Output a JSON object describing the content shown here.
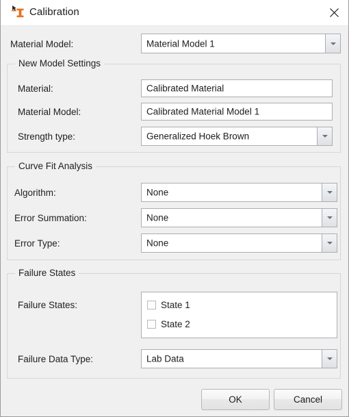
{
  "window": {
    "title": "Calibration",
    "icon": "calibration-specimen-icon",
    "close_label": "✕",
    "accent_color": "#E8731E",
    "titlebar_bg": "#FFFFFF",
    "content_bg": "#F0F0F0"
  },
  "top_field": {
    "label": "Material Model:",
    "value": "Material Model 1"
  },
  "new_model_settings": {
    "caption": "New Model Settings",
    "fields": [
      {
        "label": "Material:",
        "value": "Calibrated Material",
        "type": "textbox"
      },
      {
        "label": "Material Model:",
        "value": "Calibrated Material Model 1",
        "type": "textbox"
      },
      {
        "label": "Strength type:",
        "value": "Generalized Hoek Brown",
        "type": "combobox"
      }
    ]
  },
  "curve_fit_analysis": {
    "caption": "Curve Fit Analysis",
    "fields": [
      {
        "label": "Algorithm:",
        "value": "None",
        "type": "combobox"
      },
      {
        "label": "Error Summation:",
        "value": "None",
        "type": "combobox"
      },
      {
        "label": "Error Type:",
        "value": "None",
        "type": "combobox"
      }
    ]
  },
  "failure_states": {
    "caption": "Failure States",
    "list_label": "Failure States:",
    "items": [
      {
        "label": "State 1",
        "checked": false
      },
      {
        "label": "State 2",
        "checked": false
      }
    ],
    "data_type": {
      "label": "Failure Data Type:",
      "value": "Lab Data"
    }
  },
  "buttons": {
    "ok": "OK",
    "cancel": "Cancel"
  }
}
